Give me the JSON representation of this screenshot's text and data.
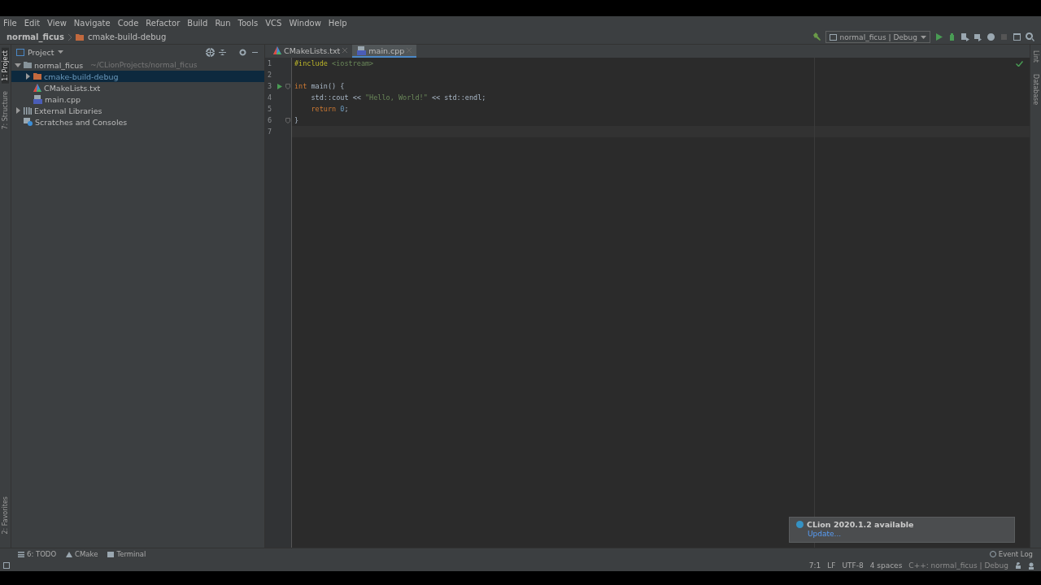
{
  "menu": [
    "File",
    "Edit",
    "View",
    "Navigate",
    "Code",
    "Refactor",
    "Build",
    "Run",
    "Tools",
    "VCS",
    "Window",
    "Help"
  ],
  "breadcrumbs": [
    {
      "label": "normal_ficus",
      "kind": "project"
    },
    {
      "label": "cmake-build-debug",
      "kind": "folder"
    }
  ],
  "run_config": {
    "label": "normal_ficus | Debug"
  },
  "left_stripe": {
    "top": [
      {
        "label": "1: Project",
        "selected": true
      },
      {
        "label": "7: Structure",
        "selected": false
      }
    ],
    "bottom": [
      {
        "label": "2: Favorites",
        "selected": false
      }
    ]
  },
  "right_stripe": [
    "Lint",
    "Database"
  ],
  "project_panel": {
    "title": "Project",
    "tree": [
      {
        "label": "normal_ficus",
        "hint": "~/CLionProjects/normal_ficus",
        "kind": "folder",
        "expanded": true,
        "selected": false,
        "children": [
          {
            "label": "cmake-build-debug",
            "kind": "build-folder",
            "expanded": false,
            "selected": true
          },
          {
            "label": "CMakeLists.txt",
            "kind": "cmake",
            "selected": false
          },
          {
            "label": "main.cpp",
            "kind": "cpp",
            "selected": false
          }
        ]
      },
      {
        "label": "External Libraries",
        "kind": "libraries",
        "expanded": false,
        "selected": false
      },
      {
        "label": "Scratches and Consoles",
        "kind": "scratches",
        "selected": false
      }
    ]
  },
  "editor": {
    "tabs": [
      {
        "label": "CMakeLists.txt",
        "kind": "cmake",
        "selected": false
      },
      {
        "label": "main.cpp",
        "kind": "cpp",
        "selected": true
      }
    ],
    "lines": [
      {
        "number": "1",
        "tokens": [
          {
            "text": "#include ",
            "kind": "preproc"
          },
          {
            "text": "<iostream>",
            "kind": "path"
          }
        ]
      },
      {
        "number": "2"
      },
      {
        "number": "3",
        "run": true,
        "fold": true,
        "tokens": [
          {
            "text": "int ",
            "kind": "keyword"
          },
          {
            "text": "main() {",
            "kind": "plain"
          }
        ]
      },
      {
        "number": "4",
        "tokens": [
          {
            "text": "    std::cout << ",
            "kind": "plain"
          },
          {
            "text": "\"Hello, World!\"",
            "kind": "string"
          },
          {
            "text": " << std::endl;",
            "kind": "plain"
          }
        ]
      },
      {
        "number": "5",
        "tokens": [
          {
            "text": "    return ",
            "kind": "keyword"
          },
          {
            "text": "0",
            "kind": "number"
          },
          {
            "text": ";",
            "kind": "plain"
          }
        ]
      },
      {
        "number": "6",
        "fold": true,
        "tokens": [
          {
            "text": "}",
            "kind": "plain"
          }
        ]
      },
      {
        "number": "7",
        "current": true
      }
    ]
  },
  "notification": {
    "title": "CLion 2020.1.2 available",
    "link": "Update..."
  },
  "tool_windows": [
    {
      "label": "6: TODO",
      "kind": "todo"
    },
    {
      "label": "CMake",
      "kind": "cmake"
    },
    {
      "label": "Terminal",
      "kind": "terminal"
    }
  ],
  "event_log": "Event Log",
  "status_bar": [
    "7:1",
    "LF",
    "UTF-8",
    "4 spaces"
  ],
  "status_context": "C++: normal_ficus | Debug"
}
